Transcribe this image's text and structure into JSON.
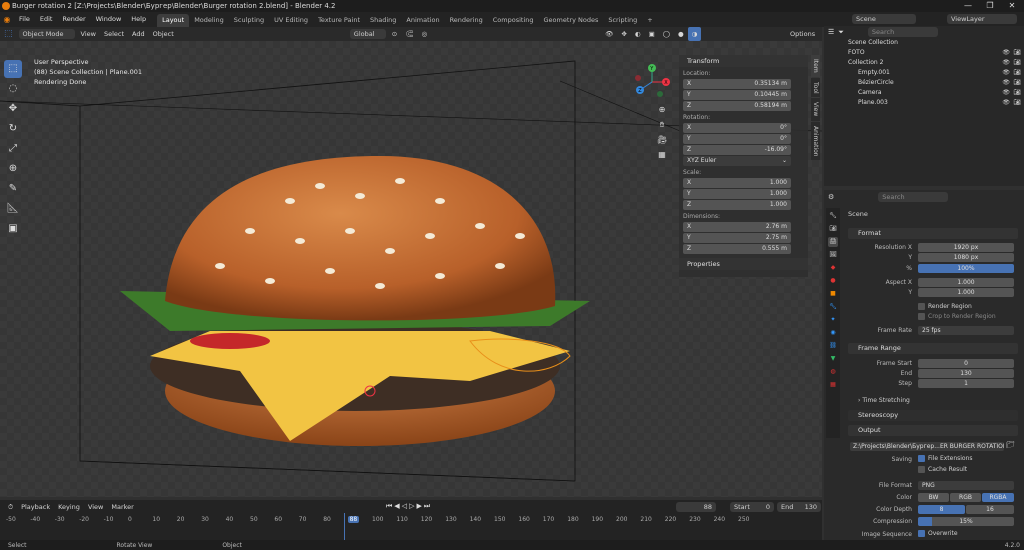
{
  "window": {
    "title": "Burger rotation 2 [Z:\\Projects\\Blender\\Бургер\\Blender\\Burger rotation 2.blend] - Blender 4.2",
    "minimize": "—",
    "maximize": "❐",
    "close": "✕"
  },
  "menubar": {
    "items": [
      "File",
      "Edit",
      "Render",
      "Window",
      "Help"
    ],
    "workspaces": [
      "Layout",
      "Modeling",
      "Sculpting",
      "UV Editing",
      "Texture Paint",
      "Shading",
      "Animation",
      "Rendering",
      "Compositing",
      "Geometry Nodes",
      "Scripting"
    ],
    "active_workspace": "Layout",
    "add_tab": "+",
    "scene_label": "Scene",
    "viewlayer_label": "ViewLayer"
  },
  "view3d_header": {
    "mode": "Object Mode",
    "menus": [
      "View",
      "Select",
      "Add",
      "Object"
    ],
    "orientation": "Global",
    "options": "Options"
  },
  "viewport": {
    "line1": "User Perspective",
    "line2": "(88) Scene Collection | Plane.001",
    "line3": "Rendering Done"
  },
  "gizmo": {
    "x": "X",
    "y": "Y",
    "z": "Z"
  },
  "vtabs": [
    "Item",
    "Tool",
    "View",
    "Animation"
  ],
  "npanel": {
    "title": "Transform",
    "location_label": "Location:",
    "location": [
      {
        "axis": "X",
        "value": "0.35134 m"
      },
      {
        "axis": "Y",
        "value": "0.10445 m"
      },
      {
        "axis": "Z",
        "value": "0.58194 m"
      }
    ],
    "rotation_label": "Rotation:",
    "rotation": [
      {
        "axis": "X",
        "value": "0°"
      },
      {
        "axis": "Y",
        "value": "0°"
      },
      {
        "axis": "Z",
        "value": "-16.09°"
      }
    ],
    "rotation_mode": "XYZ Euler",
    "scale_label": "Scale:",
    "scale": [
      {
        "axis": "X",
        "value": "1.000"
      },
      {
        "axis": "Y",
        "value": "1.000"
      },
      {
        "axis": "Z",
        "value": "1.000"
      }
    ],
    "dimensions_label": "Dimensions:",
    "dimensions": [
      {
        "axis": "X",
        "value": "2.76 m"
      },
      {
        "axis": "Y",
        "value": "2.75 m"
      },
      {
        "axis": "Z",
        "value": "0.555 m"
      }
    ],
    "properties": "Properties"
  },
  "outliner": {
    "search_placeholder": "Search",
    "root": "Scene Collection",
    "rows": [
      {
        "name": "FOTO",
        "indent": 0
      },
      {
        "name": "Collection 2",
        "indent": 0
      },
      {
        "name": "Empty.001",
        "indent": 1
      },
      {
        "name": "BézierCircle",
        "indent": 1
      },
      {
        "name": "Camera",
        "indent": 1
      },
      {
        "name": "Plane.003",
        "indent": 1
      }
    ]
  },
  "properties": {
    "search_placeholder": "Search",
    "context": "Scene",
    "format": {
      "title": "Format",
      "res_x_label": "Resolution X",
      "res_x": "1920 px",
      "y_label": "Y",
      "res_y": "1080 px",
      "pct_label": "%",
      "pct": "100%",
      "aspect_x_label": "Aspect X",
      "aspect_x": "1.000",
      "aspect_y_label": "Y",
      "aspect_y": "1.000",
      "render_region": "Render Region",
      "crop": "Crop to Render Region",
      "frame_rate_label": "Frame Rate",
      "frame_rate": "25 fps"
    },
    "frame_range": {
      "title": "Frame Range",
      "start_label": "Frame Start",
      "start": "0",
      "end_label": "End",
      "end": "130",
      "step_label": "Step",
      "step": "1",
      "time_stretching": "Time Stretching"
    },
    "stereoscopy": "Stereoscopy",
    "output": {
      "title": "Output",
      "path": "Z:\\Projects\\Blender\\Бургер...ER BURGER ROTATION 2\\",
      "saving_label": "Saving",
      "file_ext": "File Extensions",
      "cache": "Cache Result",
      "file_format_label": "File Format",
      "file_format": "PNG",
      "color_label": "Color",
      "colors": [
        "BW",
        "RGB",
        "RGBA"
      ],
      "color_active": "RGBA",
      "depth_label": "Color Depth",
      "depth": [
        "8",
        "16"
      ],
      "compression_label": "Compression",
      "compression": "15%",
      "compression_fill": 0.15,
      "image_seq_label": "Image Sequence",
      "overwrite": "Overwrite"
    }
  },
  "timeline": {
    "menus": [
      "Playback",
      "Keying",
      "View",
      "Marker"
    ],
    "current": "88",
    "start_label": "Start",
    "start": "0",
    "end_label": "End",
    "end": "130",
    "ticks": [
      "-50",
      "-40",
      "-30",
      "-20",
      "-10",
      "0",
      "10",
      "20",
      "30",
      "40",
      "50",
      "60",
      "70",
      "80",
      "88",
      "100",
      "110",
      "120",
      "130",
      "140",
      "150",
      "160",
      "170",
      "180",
      "190",
      "200",
      "210",
      "220",
      "230",
      "240",
      "250"
    ]
  },
  "status": {
    "select": "Select",
    "rotate": "Rotate View",
    "object": "Object",
    "version": "4.2.0"
  }
}
